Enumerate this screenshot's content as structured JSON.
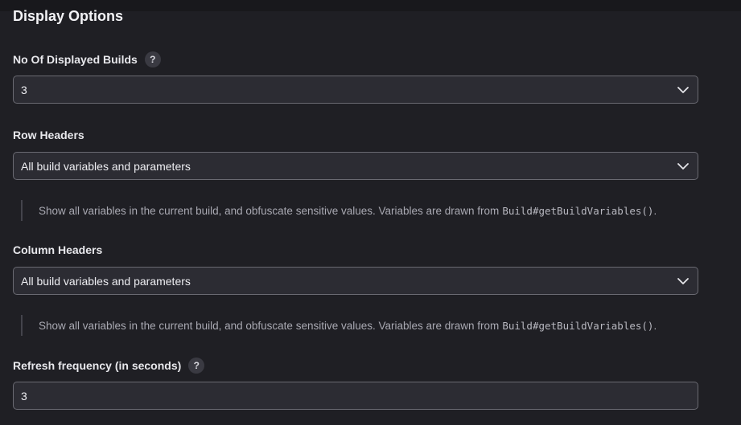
{
  "section": {
    "title": "Display Options"
  },
  "fields": {
    "displayed_builds": {
      "label": "No Of Displayed Builds",
      "help": "?",
      "value": "3"
    },
    "row_headers": {
      "label": "Row Headers",
      "value": "All build variables and parameters",
      "description_text": "Show all variables in the current build, and obfuscate sensitive values. Variables are drawn from",
      "description_code": "Build#getBuildVariables()",
      "description_end": "."
    },
    "column_headers": {
      "label": "Column Headers",
      "value": "All build variables and parameters",
      "description_text": "Show all variables in the current build, and obfuscate sensitive values. Variables are drawn from",
      "description_code": "Build#getBuildVariables()",
      "description_end": "."
    },
    "refresh_frequency": {
      "label": "Refresh frequency (in seconds)",
      "help": "?",
      "value": "3"
    }
  },
  "icons": {
    "dropdown": "chevron-down-icon",
    "help": "help-icon"
  },
  "colors": {
    "background": "#1f1f24",
    "input_background": "#2c2c33",
    "input_border": "#6a6a72",
    "text": "#e6e6ea",
    "muted_text": "#a9a9b2"
  }
}
